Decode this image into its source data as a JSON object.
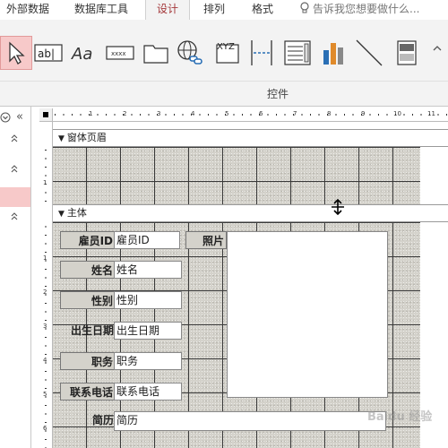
{
  "tabs": [
    {
      "label": "外部数据"
    },
    {
      "label": "数据库工具"
    },
    {
      "label": "设计"
    },
    {
      "label": "排列"
    },
    {
      "label": "格式"
    }
  ],
  "tell_me": "告诉我您想要做什么...",
  "ribbon": {
    "group_label": "控件",
    "tools": [
      {
        "icon": "select-pointer-icon"
      },
      {
        "icon": "textbox-icon",
        "text": "ab|"
      },
      {
        "icon": "label-icon",
        "text": "Aa"
      },
      {
        "icon": "button-icon",
        "text": "xxxx"
      },
      {
        "icon": "tab-control-icon"
      },
      {
        "icon": "hyperlink-icon"
      },
      {
        "icon": "web-browser-icon",
        "text": "XYZ"
      },
      {
        "icon": "page-break-icon"
      },
      {
        "icon": "subform-icon"
      },
      {
        "icon": "chart-icon"
      },
      {
        "icon": "line-icon"
      },
      {
        "icon": "toggle-icon"
      }
    ]
  },
  "ruler": {
    "h_numbers": [
      "1",
      "2",
      "3",
      "4",
      "5",
      "6",
      "7",
      "8",
      "9",
      "10",
      "11"
    ],
    "v_numbers_header": [
      "1"
    ],
    "v_numbers_detail": [
      "1",
      "2",
      "3",
      "4",
      "5",
      "6"
    ]
  },
  "sections": {
    "form_header": "窗体页眉",
    "detail": "主体"
  },
  "fields": [
    {
      "label": "雇员ID",
      "value": "雇员ID"
    },
    {
      "label": "姓名",
      "value": "姓名"
    },
    {
      "label": "性别",
      "value": "性别"
    },
    {
      "label": "出生日期",
      "value": "出生日期"
    },
    {
      "label": "职务",
      "value": "职务"
    },
    {
      "label": "联系电话",
      "value": "联系电话"
    },
    {
      "label": "简历",
      "value": "简历"
    }
  ],
  "photo_label": "照片",
  "watermark": "Baidu 经验"
}
